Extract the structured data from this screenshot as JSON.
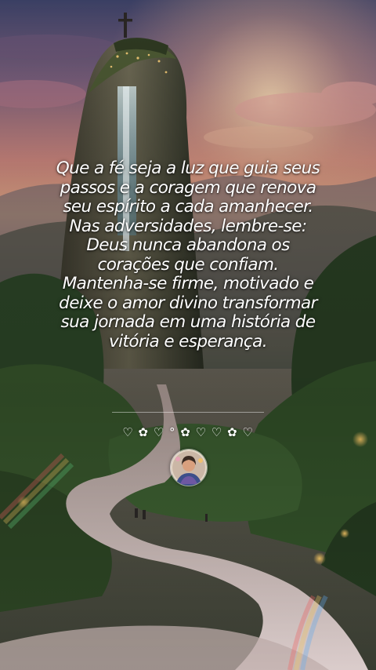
{
  "quote": {
    "lines": [
      "Que a fé seja a luz que guia seus",
      "passos e a coragem que renova",
      "seu espírito a cada amanhecer.",
      "Nas adversidades, lembre-se:",
      "Deus nunca abandona os",
      "corações que confiam.",
      "Mantenha-se firme, motivado e",
      "deixe o amor divino transformar",
      "sua jornada em uma história de",
      "vitória e esperança."
    ]
  },
  "decoration": {
    "symbols": "♡ ✿ ♡ ° ✿ ♡ ♡ ✿ ♡"
  },
  "colors": {
    "sky_top": "#3a3f63",
    "sky_glow": "#f2b58f",
    "foliage": "#2f4a2a",
    "path": "#d8c9c8",
    "text": "#ffffff"
  }
}
